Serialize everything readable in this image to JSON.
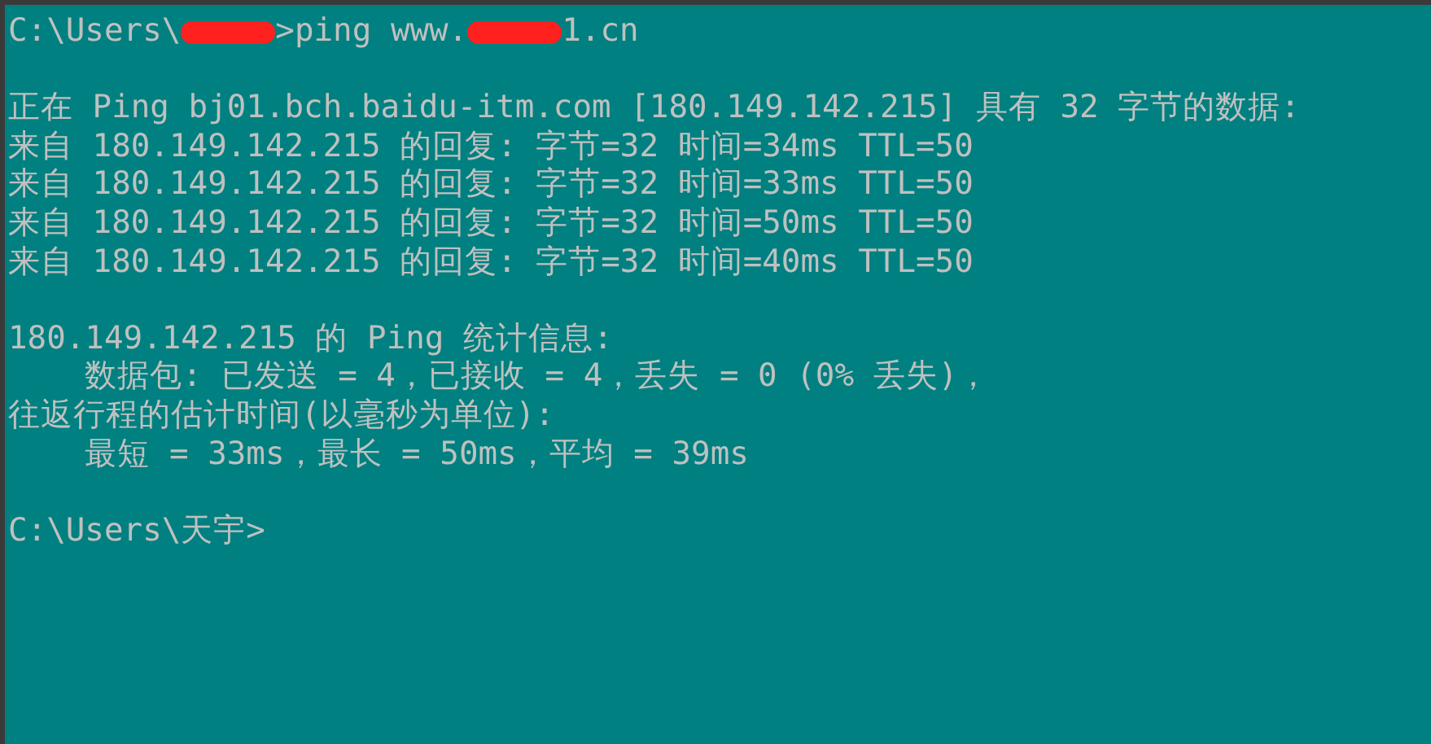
{
  "console": {
    "lines": [
      {
        "kind": "command",
        "parts": [
          {
            "kind": "text",
            "text": "C:\\Users\\"
          },
          {
            "kind": "redaction"
          },
          {
            "kind": "text",
            "text": ">ping www."
          },
          {
            "kind": "redaction"
          },
          {
            "kind": "text",
            "text": "1.cn"
          }
        ]
      },
      {
        "kind": "blank"
      },
      {
        "kind": "text",
        "text": "正在 Ping bj01.bch.baidu-itm.com [180.149.142.215] 具有 32 字节的数据:"
      },
      {
        "kind": "text",
        "text": "来自 180.149.142.215 的回复: 字节=32 时间=34ms TTL=50"
      },
      {
        "kind": "text",
        "text": "来自 180.149.142.215 的回复: 字节=32 时间=33ms TTL=50"
      },
      {
        "kind": "text",
        "text": "来自 180.149.142.215 的回复: 字节=32 时间=50ms TTL=50"
      },
      {
        "kind": "text",
        "text": "来自 180.149.142.215 的回复: 字节=32 时间=40ms TTL=50"
      },
      {
        "kind": "blank"
      },
      {
        "kind": "text",
        "text": "180.149.142.215 的 Ping 统计信息:"
      },
      {
        "kind": "text",
        "text": "    数据包: 已发送 = 4，已接收 = 4，丢失 = 0 (0% 丢失)，"
      },
      {
        "kind": "text",
        "text": "往返行程的估计时间(以毫秒为单位):"
      },
      {
        "kind": "text",
        "text": "    最短 = 33ms，最长 = 50ms，平均 = 39ms"
      },
      {
        "kind": "blank"
      },
      {
        "kind": "text",
        "text": "C:\\Users\\天宇>"
      }
    ]
  }
}
